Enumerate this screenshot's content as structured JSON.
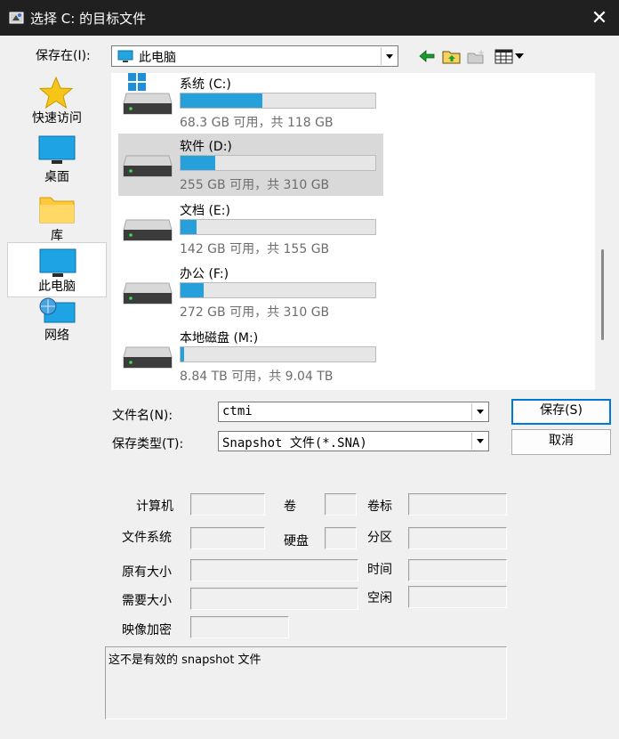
{
  "window": {
    "title": "选择 C: 的目标文件",
    "close_glyph": "✕",
    "icon": "app-icon"
  },
  "save_in": {
    "label": "保存在(I):",
    "value": "此电脑",
    "toolbar": [
      "back-arrow-icon",
      "up-folder-icon",
      "new-folder-icon",
      "view-menu-icon"
    ]
  },
  "places": [
    {
      "label": "快速访问",
      "icon": "star-icon"
    },
    {
      "label": "桌面",
      "icon": "desktop-icon"
    },
    {
      "label": "库",
      "icon": "folder-icon"
    },
    {
      "label": "此电脑",
      "icon": "computer-icon",
      "selected": true
    },
    {
      "label": "网络",
      "icon": "network-icon"
    }
  ],
  "drives": [
    {
      "name": "系统 (C:)",
      "size_text": "68.3 GB 可用，共 118 GB",
      "used_fraction": 0.42,
      "selected": false,
      "windows_logo": true
    },
    {
      "name": "软件 (D:)",
      "size_text": "255 GB 可用，共 310 GB",
      "used_fraction": 0.18,
      "selected": true
    },
    {
      "name": "文档 (E:)",
      "size_text": "142 GB 可用，共 155 GB",
      "used_fraction": 0.08,
      "selected": false
    },
    {
      "name": "办公 (F:)",
      "size_text": "272 GB 可用，共 310 GB",
      "used_fraction": 0.12,
      "selected": false
    },
    {
      "name": "本地磁盘 (M:)",
      "size_text": "8.84 TB 可用，共 9.04 TB",
      "used_fraction": 0.02,
      "selected": false
    }
  ],
  "filename": {
    "label": "文件名(N):",
    "value": "ctmi"
  },
  "filetype": {
    "label": "保存类型(T):",
    "value": "Snapshot 文件(*.SNA)"
  },
  "buttons": {
    "save": "保存(S)",
    "cancel": "取消"
  },
  "info": {
    "computer": "计算机",
    "volume": "卷",
    "volume_label": "卷标",
    "filesystem": "文件系统",
    "disk": "硬盘",
    "partition": "分区",
    "original_size": "原有大小",
    "time": "时间",
    "required_size": "需要大小",
    "free": "空闲",
    "encryption": "映像加密"
  },
  "status_message": "这不是有效的 snapshot 文件",
  "colors": {
    "accent": "#0078d4",
    "bar_fill": "#26a0da",
    "titlebar": "#202020"
  }
}
